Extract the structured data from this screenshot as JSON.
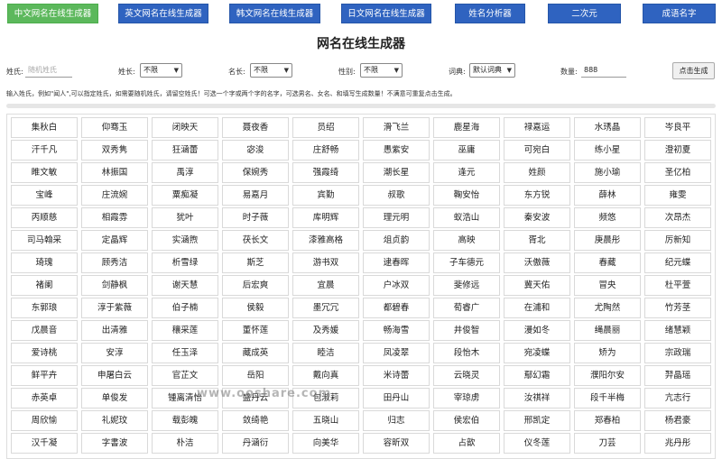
{
  "nav": [
    {
      "label": "中文网名在线生成器",
      "active": true
    },
    {
      "label": "英文网名在线生成器",
      "active": false
    },
    {
      "label": "韩文网名在线生成器",
      "active": false
    },
    {
      "label": "日文网名在线生成器",
      "active": false
    },
    {
      "label": "姓名分析器",
      "active": false
    },
    {
      "label": "二次元",
      "active": false
    },
    {
      "label": "成语名字",
      "active": false
    }
  ],
  "title": "网名在线生成器",
  "form": {
    "surname_label": "姓氏:",
    "surname_placeholder": "随机姓氏",
    "surname_len_label": "姓长:",
    "surname_len_value": "不限",
    "name_len_label": "名长:",
    "name_len_value": "不限",
    "gender_label": "性别:",
    "gender_value": "不限",
    "dict_label": "词典:",
    "dict_value": "默认词典",
    "count_label": "数量:",
    "count_value": "888",
    "generate_label": "点击生成"
  },
  "hint": "输入姓氏，例如\"闻人\",可以指定姓氏，如需要随机姓氏，请留空姓氏！可选一个字或两个字的名字，可选男名、女名、和填写生成数量！不满意可重复点击生成。",
  "names": [
    "集秋白",
    "仰骞玉",
    "闭映天",
    "聂夜香",
    "员绍",
    "滑飞兰",
    "鹿星海",
    "禄嘉运",
    "水琇晶",
    "岑良平",
    "汗千凡",
    "双秀隽",
    "狂涵蕾",
    "宓浚",
    "庄舒畅",
    "愚紫安",
    "巫庸",
    "可宛白",
    "练小星",
    "澄初夏",
    "睢文敏",
    "林振国",
    "禹淳",
    "保婉秀",
    "强霞绮",
    "潮长星",
    "逢元",
    "姓颜",
    "施小瑜",
    "圣亿柏",
    "宝峰",
    "庄流婉",
    "粟痴凝",
    "易嘉月",
    "宾勤",
    "叔歌",
    "鞠安怡",
    "东方锐",
    "薛林",
    "雍雯",
    "丙顺慈",
    "相霞雰",
    "犹叶",
    "时子薇",
    "库明辉",
    "理元明",
    "蚁浩山",
    "秦安波",
    "频悠",
    "次昂杰",
    "司马翰采",
    "定晶辉",
    "实涵煦",
    "茯长文",
    "漆雅高格",
    "俎贞韵",
    "高映",
    "胥北",
    "庚晨彤",
    "厉新知",
    "琦瑰",
    "顾秀洁",
    "析雪绿",
    "斯芝",
    "游书双",
    "逮春晖",
    "子车德元",
    "沃傲薇",
    "春藏",
    "纪元蝶",
    "褚阑",
    "剑静枫",
    "谢天慧",
    "后宏爽",
    "宜晨",
    "户冰双",
    "斐修远",
    "冀天佑",
    "冒央",
    "杜平萱",
    "东郭琅",
    "淳于紫薇",
    "伯子楠",
    "侯毅",
    "墨冗冗",
    "都碧春",
    "荀睿广",
    "在浦和",
    "尤陶然",
    "竹芳茎",
    "戊晨音",
    "出清雅",
    "穰采莲",
    "董怀莲",
    "及秀媛",
    "畅海雪",
    "井俊智",
    "漫如冬",
    "绳晨丽",
    "绪慧颖",
    "爱诗桃",
    "安淳",
    "任玉泽",
    "藏成英",
    "睦洁",
    "凤凌翠",
    "段怡木",
    "宛凌蝶",
    "矫为",
    "宗政瑞",
    "鲜平卉",
    "申屠白云",
    "官芷文",
    "岳阳",
    "戴向真",
    "米诗蕾",
    "云晓灵",
    "鄢幻霜",
    "濮阳尔安",
    "羿晶瑶",
    "赤英卓",
    "单俊发",
    "锺离清怡",
    "盛丹云",
    "包淑莉",
    "田丹山",
    "宰琼虏",
    "汝祺祥",
    "段千半梅",
    "亢志行",
    "周欣愉",
    "礼妮玟",
    "载彭魄",
    "敛绮艳",
    "五晓山",
    "归志",
    "侯宏伯",
    "邢凯定",
    "郑春柏",
    "杨君豪",
    "汉千凝",
    "字書波",
    "朴洁",
    "丹涵衍",
    "向美华",
    "容昕双",
    "占歆",
    "仪冬莲",
    "刀芸",
    "兆丹彤"
  ],
  "watermark": "www.ooshare.com"
}
